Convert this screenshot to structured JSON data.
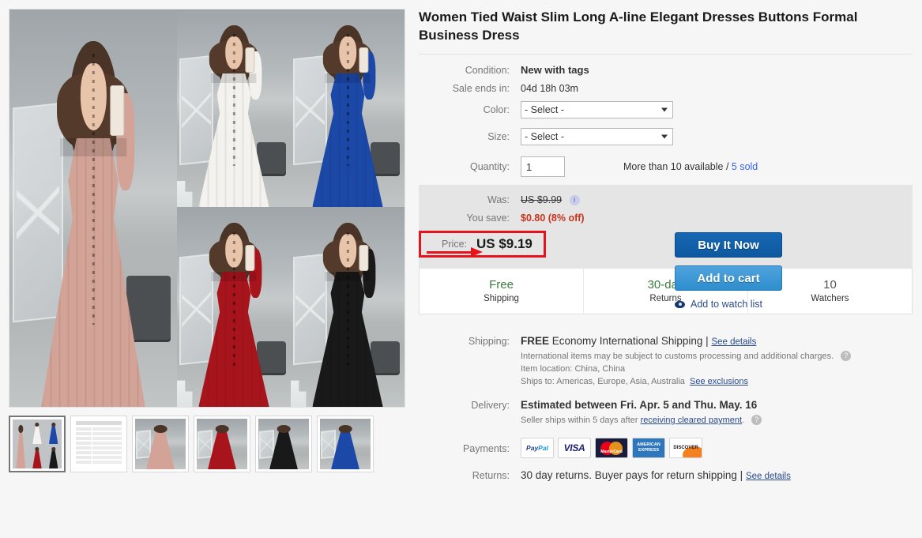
{
  "product": {
    "title": "Women Tied Waist Slim Long A-line Elegant Dresses Buttons Formal Business Dress"
  },
  "attributes": {
    "condition_label": "Condition:",
    "condition_value": "New with tags",
    "sale_ends_label": "Sale ends in:",
    "sale_ends_value": "04d 18h 03m",
    "color_label": "Color:",
    "color_value": "- Select -",
    "size_label": "Size:",
    "size_value": "- Select -",
    "quantity_label": "Quantity:",
    "quantity_value": "1",
    "availability_prefix": "More than 10 available / ",
    "sold_link": "5 sold"
  },
  "pricing": {
    "was_label": "Was:",
    "was_value": "US $9.99",
    "was_info_icon": "info-icon",
    "save_label": "You save:",
    "save_value": "$0.80 (8% off)",
    "price_label": "Price:",
    "price_value": "US $9.19",
    "highlight_color": "#e8121b",
    "save_color": "#c7331c"
  },
  "actions": {
    "buy_now": "Buy It Now",
    "add_to_cart": "Add to cart",
    "watch_list": "Add to watch list",
    "watch_icon": "eye-icon"
  },
  "benefits": [
    {
      "primary": "Free",
      "secondary": "Shipping",
      "style": "green"
    },
    {
      "primary": "30-day",
      "secondary": "Returns",
      "style": "green"
    },
    {
      "primary": "10",
      "secondary": "Watchers",
      "style": "gray"
    }
  ],
  "shipping": {
    "label": "Shipping:",
    "free": "FREE",
    "method": "Economy International Shipping",
    "separator": "|",
    "see_details": "See details",
    "customs_note": "International items may be subject to customs processing and additional charges.",
    "item_location_label": "Item location:",
    "item_location_value": "China, China",
    "ships_to_label": "Ships to:",
    "ships_to_value": "Americas, Europe, Asia, Australia",
    "see_exclusions": "See exclusions",
    "help_icon": "question-mark-icon"
  },
  "delivery": {
    "label": "Delivery:",
    "estimate": "Estimated between Fri. Apr. 5 and Thu. May. 16",
    "note_prefix": "Seller ships within 5 days after ",
    "note_link": "receiving cleared payment",
    "note_suffix": ".",
    "help_icon": "question-mark-icon"
  },
  "payments": {
    "label": "Payments:",
    "methods": [
      "PayPal",
      "VISA",
      "MasterCard",
      "AMERICAN EXPRESS",
      "DISCOVER"
    ]
  },
  "returns": {
    "label": "Returns:",
    "policy": "30 day returns. Buyer pays for return shipping",
    "separator": "|",
    "see_details": "See details"
  },
  "gallery": {
    "main_alt": "product-collage-five-dress-colors",
    "thumbnails": [
      {
        "name": "thumb-collage",
        "type": "collage",
        "selected": true
      },
      {
        "name": "thumb-size-chart",
        "type": "chart",
        "selected": false
      },
      {
        "name": "thumb-pink",
        "type": "figure",
        "color": "#d3a397",
        "selected": false
      },
      {
        "name": "thumb-red",
        "type": "figure",
        "color": "#a8141c",
        "selected": false
      },
      {
        "name": "thumb-black",
        "type": "figure",
        "color": "#191919",
        "selected": false
      },
      {
        "name": "thumb-blue",
        "type": "figure",
        "color": "#1c48a8",
        "selected": false
      }
    ]
  }
}
